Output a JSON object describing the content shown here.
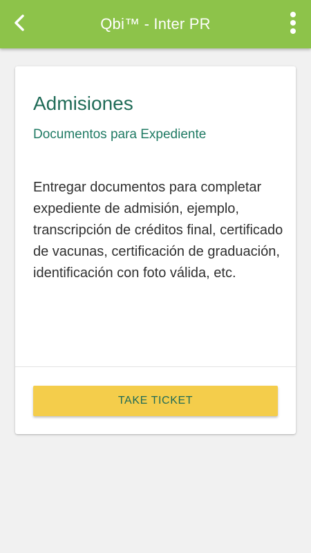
{
  "colors": {
    "app_bar": "#8dc34a",
    "accent_text": "#1f6b57",
    "button": "#f4cd4b",
    "background": "#f1f1f1"
  },
  "header": {
    "back_icon": "chevron-left-icon",
    "title": "Qbi™ - Inter PR",
    "menu_icon": "more-vert-icon"
  },
  "card": {
    "title": "Admisiones",
    "subtitle": "Documentos para Expediente",
    "description": "Entregar documentos para completar expediente de admisión, ejemplo, transcripción de créditos final, certificado de vacunas, certificación de graduación, identificación con foto válida, etc.",
    "button_label": "TAKE TICKET"
  }
}
